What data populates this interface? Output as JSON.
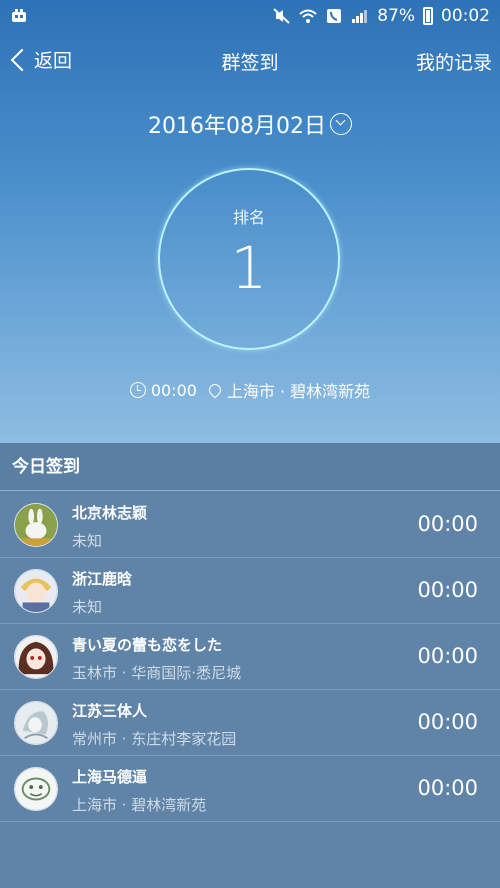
{
  "status_bar": {
    "battery": "87%",
    "time": "00:02"
  },
  "nav": {
    "back_label": "返回",
    "title": "群签到",
    "record_label": "我的记录"
  },
  "date": "2016年08月02日",
  "rank": {
    "label": "排名",
    "value": "1"
  },
  "info": {
    "time": "00:00",
    "location": "上海市 · 碧林湾新苑"
  },
  "section_title": "今日签到",
  "checkins": [
    {
      "name": "北京林志颖",
      "location": "未知",
      "time": "00:00",
      "avatar_icon": "rabbit-avatar"
    },
    {
      "name": "浙江鹿晗",
      "location": "未知",
      "time": "00:00",
      "avatar_icon": "anime-boy-avatar"
    },
    {
      "name": "青い夏の蕾も恋をした",
      "location": "玉林市 · 华商国际·悉尼城",
      "time": "00:00",
      "avatar_icon": "anime-girl-avatar"
    },
    {
      "name": "江苏三体人",
      "location": "常州市 · 东庄村李家花园",
      "time": "00:00",
      "avatar_icon": "sketch-avatar"
    },
    {
      "name": "上海马德逼",
      "location": "上海市 · 碧林湾新苑",
      "time": "00:00",
      "avatar_icon": "doodle-avatar"
    }
  ]
}
